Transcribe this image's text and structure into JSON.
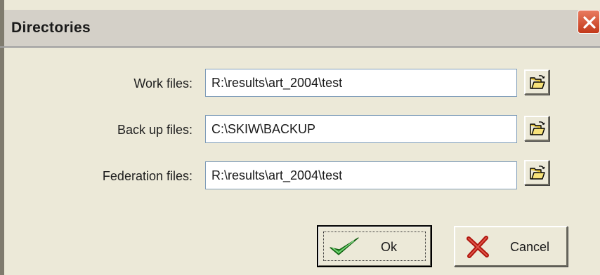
{
  "window": {
    "title": "Directories"
  },
  "fields": [
    {
      "label": "Work files:",
      "value": "R:\\results\\art_2004\\test"
    },
    {
      "label": "Back up files:",
      "value": "C:\\SKIW\\BACKUP"
    },
    {
      "label": "Federation files:",
      "value": "R:\\results\\art_2004\\test"
    }
  ],
  "buttons": {
    "ok_label": "Ok",
    "cancel_label": "Cancel"
  },
  "icons": {
    "close": "close-icon",
    "browse": "open-folder-icon",
    "ok": "checkmark-icon",
    "cancel": "x-mark-icon"
  },
  "colors": {
    "face": "#ece9d8",
    "close_red": "#c2391a",
    "check_green": "#2c9c2c",
    "cancel_red": "#b0160e"
  }
}
